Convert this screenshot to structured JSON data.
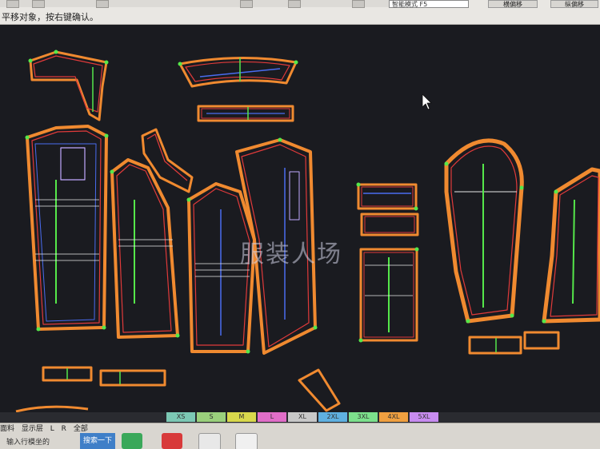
{
  "status_text": "平移对象，按右键确认。",
  "mode_label": "智能模式 F5",
  "right_buttons": [
    "横偏移",
    "纵偏移"
  ],
  "watermark": "服装人场",
  "sizes": [
    {
      "label": "XS",
      "color": "#7cc8b4"
    },
    {
      "label": "S",
      "color": "#9ad07c"
    },
    {
      "label": "M",
      "color": "#d8d84c"
    },
    {
      "label": "L",
      "color": "#e06ec8"
    },
    {
      "label": "XL",
      "color": "#c8c8c8"
    },
    {
      "label": "2XL",
      "color": "#5fb0e0"
    },
    {
      "label": "3XL",
      "color": "#7ce08c"
    },
    {
      "label": "4XL",
      "color": "#f0a040"
    },
    {
      "label": "5XL",
      "color": "#c88cf0"
    }
  ],
  "bottom_tabs": [
    "面料",
    "显示层",
    "L",
    "R",
    "全部"
  ],
  "input_prompt": "输入行模坐的",
  "next_button": "搜索一下",
  "accent_green": "#55e84a",
  "accent_orange": "#f08a30",
  "accent_red": "#e03a3a",
  "accent_blue": "#4a6cf0"
}
